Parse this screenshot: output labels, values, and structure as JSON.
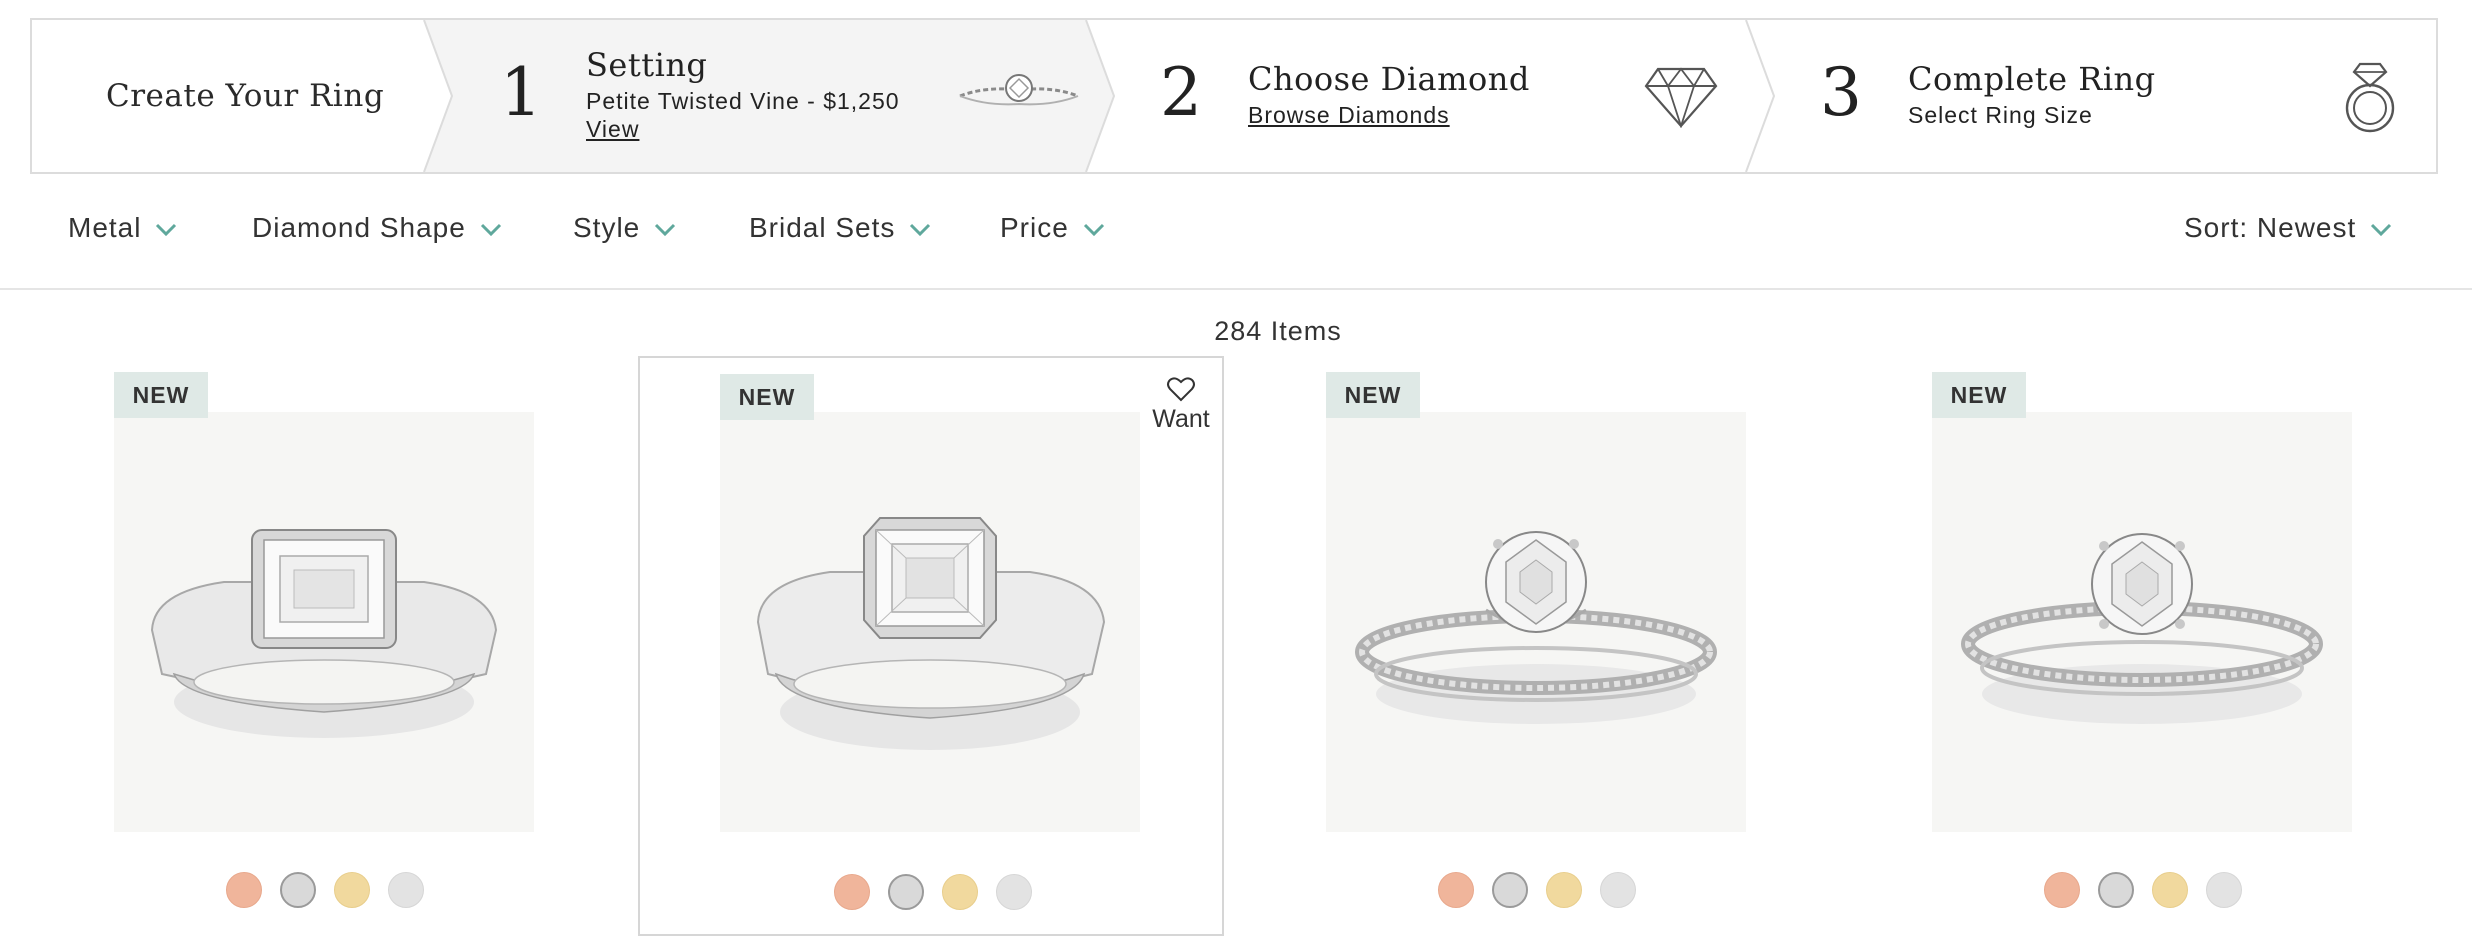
{
  "stepbar": {
    "intro": "Create Your Ring",
    "step1": {
      "num": "1",
      "title": "Setting",
      "sub": "Petite Twisted Vine - $1,250",
      "link": "View"
    },
    "step2": {
      "num": "2",
      "title": "Choose Diamond",
      "link": "Browse Diamonds"
    },
    "step3": {
      "num": "3",
      "title": "Complete Ring",
      "sub": "Select Ring Size"
    }
  },
  "filters": [
    "Metal",
    "Diamond Shape",
    "Style",
    "Bridal Sets",
    "Price"
  ],
  "sort_label": "Sort: Newest",
  "item_count": "284 Items",
  "products": [
    {
      "badge": "NEW",
      "style": "bezel-emerald"
    },
    {
      "badge": "NEW",
      "style": "bezel-asscher",
      "want_label": "Want"
    },
    {
      "badge": "NEW",
      "style": "pave-round-hidden-halo"
    },
    {
      "badge": "NEW",
      "style": "pave-round"
    }
  ],
  "metal_swatches": [
    "rose",
    "white",
    "yellow",
    "platinum"
  ],
  "colors": {
    "accent": "#5fa89c",
    "badge_bg": "#dfe9e6",
    "step_active_bg": "#f4f4f4"
  }
}
